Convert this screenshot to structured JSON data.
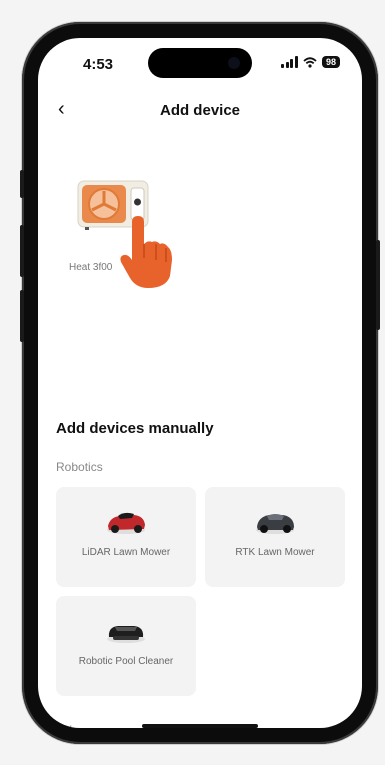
{
  "status_bar": {
    "time": "4:53",
    "battery": "98"
  },
  "header": {
    "back_icon": "‹",
    "title": "Add device"
  },
  "discovered": {
    "label": "Heat      3f00"
  },
  "manual": {
    "section_title": "Add devices manually",
    "category": "Robotics",
    "items": [
      {
        "label": "LiDAR Lawn Mower"
      },
      {
        "label": "RTK Lawn Mower"
      },
      {
        "label": "Robotic Pool Cleaner"
      }
    ],
    "next_category_partial": "ool"
  },
  "colors": {
    "accent": "#e8632b",
    "background": "#ffffff",
    "tile": "#f3f3f3"
  }
}
